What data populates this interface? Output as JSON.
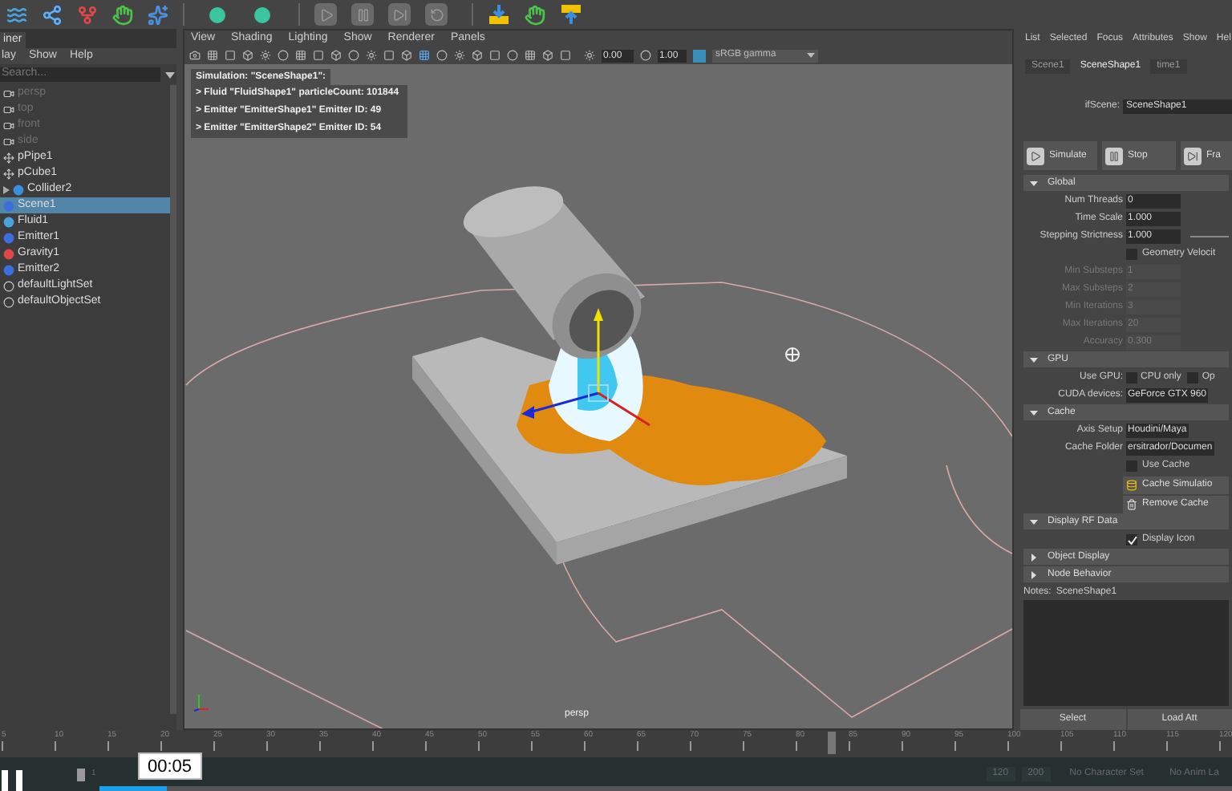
{
  "outliner": {
    "title": "iner",
    "menu": [
      "lay",
      "Show",
      "Help"
    ],
    "search": {
      "placeholder": "Search..."
    },
    "items": [
      {
        "label": "persp",
        "kind": "camera",
        "dimmed": true,
        "selected": false,
        "expandable": false
      },
      {
        "label": "top",
        "kind": "camera",
        "dimmed": true,
        "selected": false,
        "expandable": false
      },
      {
        "label": "front",
        "kind": "camera",
        "dimmed": true,
        "selected": false,
        "expandable": false
      },
      {
        "label": "side",
        "kind": "camera",
        "dimmed": true,
        "selected": false,
        "expandable": false
      },
      {
        "label": "pPipe1",
        "kind": "mesh",
        "dimmed": false,
        "selected": false,
        "expandable": false
      },
      {
        "label": "pCube1",
        "kind": "mesh",
        "dimmed": false,
        "selected": false,
        "expandable": false
      },
      {
        "label": "Collider2",
        "kind": "collider",
        "dimmed": false,
        "selected": false,
        "expandable": true
      },
      {
        "label": "Scene1",
        "kind": "scene",
        "dimmed": false,
        "selected": true,
        "expandable": false
      },
      {
        "label": "Fluid1",
        "kind": "fluid",
        "dimmed": false,
        "selected": false,
        "expandable": false
      },
      {
        "label": "Emitter1",
        "kind": "emitter",
        "dimmed": false,
        "selected": false,
        "expandable": false
      },
      {
        "label": "Gravity1",
        "kind": "gravity",
        "dimmed": false,
        "selected": false,
        "expandable": false
      },
      {
        "label": "Emitter2",
        "kind": "emitter",
        "dimmed": false,
        "selected": false,
        "expandable": false
      },
      {
        "label": "defaultLightSet",
        "kind": "set",
        "dimmed": false,
        "selected": false,
        "expandable": false
      },
      {
        "label": "defaultObjectSet",
        "kind": "set",
        "dimmed": false,
        "selected": false,
        "expandable": false
      }
    ]
  },
  "viewport": {
    "menu": [
      "View",
      "Shading",
      "Lighting",
      "Show",
      "Renderer",
      "Panels"
    ],
    "exposure": "0.00",
    "gamma": "1.00",
    "color_space": "sRGB gamma",
    "hud": {
      "title": "Simulation: \"SceneShape1\":",
      "lines": [
        "> Fluid \"FluidShape1\" particleCount: 101844",
        "> Emitter \"EmitterShape1\" Emitter ID: 49",
        "> Emitter \"EmitterShape2\" Emitter ID: 54"
      ]
    },
    "camera": "persp"
  },
  "attribute_editor": {
    "menu": [
      "List",
      "Selected",
      "Focus",
      "Attributes",
      "Show",
      "Hel"
    ],
    "tabs": [
      {
        "label": "Scene1",
        "selected": false
      },
      {
        "label": "SceneShape1",
        "selected": true
      },
      {
        "label": "time1",
        "selected": false
      }
    ],
    "node": {
      "label": "ifScene:",
      "value": "SceneShape1"
    },
    "actions": [
      {
        "label": "Simulate",
        "kind": "play"
      },
      {
        "label": "Stop",
        "kind": "pause"
      },
      {
        "label": "Fra",
        "kind": "step"
      }
    ],
    "sections": [
      {
        "title": "Global",
        "expanded": true,
        "rows": [
          {
            "kind": "field",
            "label": "Num Threads",
            "value": "0",
            "disabled": false
          },
          {
            "kind": "field",
            "label": "Time Scale",
            "value": "1.000",
            "disabled": false
          },
          {
            "kind": "slider",
            "label": "Stepping Strictness",
            "value": "1.000",
            "disabled": false
          },
          {
            "kind": "checkbox",
            "label": "Geometry Velocit",
            "checked": false
          },
          {
            "kind": "field",
            "label": "Min Substeps",
            "value": "1",
            "disabled": true
          },
          {
            "kind": "field",
            "label": "Max Substeps",
            "value": "2",
            "disabled": true
          },
          {
            "kind": "field",
            "label": "Min Iterations",
            "value": "3",
            "disabled": true
          },
          {
            "kind": "field",
            "label": "Max Iterations",
            "value": "20",
            "disabled": true
          },
          {
            "kind": "field",
            "label": "Accuracy",
            "value": "0.300",
            "disabled": true
          }
        ]
      },
      {
        "title": "GPU",
        "expanded": true,
        "rows": [
          {
            "kind": "options",
            "label": "Use GPU:",
            "options": [
              {
                "label": "CPU only",
                "checked": false
              },
              {
                "label": "Op",
                "checked": false
              }
            ]
          },
          {
            "kind": "field",
            "label": "CUDA devices:",
            "value": "GeForce GTX 960",
            "disabled": false
          }
        ]
      },
      {
        "title": "Cache",
        "expanded": true,
        "rows": [
          {
            "kind": "field",
            "label": "Axis Setup",
            "value": "Houdini/Maya",
            "disabled": false
          },
          {
            "kind": "field",
            "label": "Cache Folder",
            "value": "ersitrador/Documen",
            "disabled": false
          },
          {
            "kind": "checkbox",
            "label": "Use Cache",
            "checked": false
          },
          {
            "kind": "cache_button",
            "label": "Cache Simulatio"
          },
          {
            "kind": "remove_button",
            "label": "Remove Cache"
          }
        ]
      },
      {
        "title": "Display RF Data",
        "expanded": true,
        "rows": [
          {
            "kind": "checkbox",
            "label": "Display Icon",
            "checked": true
          }
        ]
      },
      {
        "title": "Object Display",
        "expanded": false
      },
      {
        "title": "Node Behavior",
        "expanded": false
      }
    ],
    "notes": {
      "label": "Notes:",
      "value": "SceneShape1"
    },
    "buttons": [
      "Select",
      "Load Att"
    ]
  },
  "timeline": {
    "ticks": [
      "5",
      "10",
      "15",
      "20",
      "25",
      "30",
      "35",
      "40",
      "45",
      "50",
      "55",
      "60",
      "65",
      "70",
      "75",
      "80",
      "85",
      "90",
      "95",
      "100",
      "105",
      "110",
      "115",
      "120"
    ],
    "range_start": "1",
    "range_end": "120",
    "anim_end": "200",
    "character_set": "No Character Set",
    "anim_layer": "No Anim La"
  },
  "video_player": {
    "time": "00:05",
    "level": 0.06
  }
}
